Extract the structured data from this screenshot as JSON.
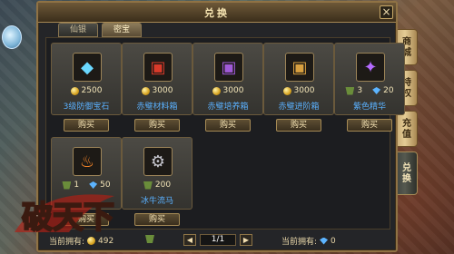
{
  "window": {
    "title": "兑换",
    "close": "×"
  },
  "tabs": [
    {
      "label": "仙银"
    },
    {
      "label": "密宝"
    }
  ],
  "side_tabs": [
    {
      "label": "商城"
    },
    {
      "label": "特权"
    },
    {
      "label": "充值"
    },
    {
      "label": "兑换"
    }
  ],
  "items": [
    {
      "name": "3级防御宝石",
      "icon": "blue-crystal-icon",
      "glyph": "◆",
      "glyph_color": "#6ad8ff",
      "cost_icon": "coin",
      "price": "2500",
      "buy": "购买"
    },
    {
      "name": "赤璧材料箱",
      "icon": "red-chest-icon",
      "glyph": "▣",
      "glyph_color": "#d93a2a",
      "cost_icon": "coin",
      "price": "3000",
      "buy": "购买"
    },
    {
      "name": "赤璧培养箱",
      "icon": "purple-chest-icon",
      "glyph": "▣",
      "glyph_color": "#a05ad8",
      "cost_icon": "coin",
      "price": "3000",
      "buy": "购买"
    },
    {
      "name": "赤璧进阶箱",
      "icon": "gold-chest-icon",
      "glyph": "▣",
      "glyph_color": "#d8a040",
      "cost_icon": "coin",
      "price": "3000",
      "buy": "购买"
    },
    {
      "name": "紫色精华",
      "icon": "purple-essence-icon",
      "glyph": "✦",
      "glyph_color": "#b46bff",
      "cost_icon": "scroll",
      "price": "3",
      "cost_icon2": "gem",
      "price2": "20",
      "buy": "购买"
    },
    {
      "name": "",
      "icon": "fire-lantern-icon",
      "glyph": "♨",
      "glyph_color": "#ff8a2a",
      "cost_icon": "scroll",
      "price": "1",
      "cost_icon2": "gem",
      "price2": "50",
      "buy": "购买"
    },
    {
      "name": "冰牛流马",
      "icon": "mech-mount-icon",
      "glyph": "⚙",
      "glyph_color": "#c8c8d0",
      "cost_icon": "scroll",
      "price": "200",
      "buy": "购买"
    }
  ],
  "footer": {
    "owned_label_left": "当前拥有:",
    "owned_left_value": "492",
    "page": "1/1",
    "owned_label_right": "当前拥有:",
    "owned_right_value": "0"
  },
  "logo": {
    "text": "破天下"
  },
  "colors": {
    "accent_gold": "#8f7244",
    "name_blue": "#5ab1ff",
    "window_bg": "#242528"
  }
}
